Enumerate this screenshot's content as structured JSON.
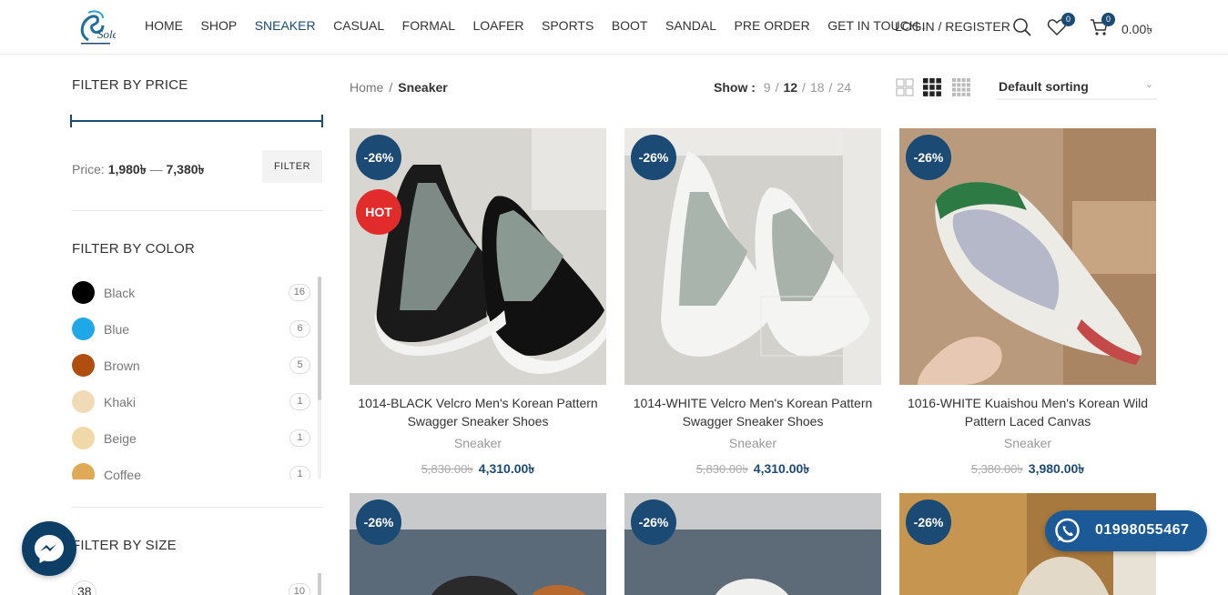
{
  "brand": {
    "logo_text": "Sole",
    "accent": "#1b4a74",
    "hot_color": "#e22b2b"
  },
  "nav": {
    "items": [
      {
        "label": "HOME"
      },
      {
        "label": "SHOP"
      },
      {
        "label": "SNEAKER"
      },
      {
        "label": "CASUAL"
      },
      {
        "label": "FORMAL"
      },
      {
        "label": "LOAFER"
      },
      {
        "label": "SPORTS"
      },
      {
        "label": "BOOT"
      },
      {
        "label": "SANDAL"
      },
      {
        "label": "PRE ORDER"
      },
      {
        "label": "GET IN TOUCH"
      }
    ],
    "active": "SNEAKER",
    "login": "LOGIN / REGISTER",
    "wishlist_count": "0",
    "cart_count": "0",
    "cart_total": "0.00৳"
  },
  "sidebar": {
    "price_title": "FILTER BY PRICE",
    "price_label": "Price:",
    "price_min": "1,980৳",
    "price_dash": "—",
    "price_max": "7,380৳",
    "filter_button": "FILTER",
    "color_title": "FILTER BY COLOR",
    "colors": [
      {
        "name": "Black",
        "count": "16",
        "hex": "#000000"
      },
      {
        "name": "Blue",
        "count": "6",
        "hex": "#1ea8e8"
      },
      {
        "name": "Brown",
        "count": "5",
        "hex": "#b04e0f"
      },
      {
        "name": "Khaki",
        "count": "1",
        "hex": "#f0dbb6"
      },
      {
        "name": "Beige",
        "count": "1",
        "hex": "#f0d8a8"
      },
      {
        "name": "Coffee",
        "count": "1",
        "hex": "#dfaa55"
      }
    ],
    "size_title": "FILTER BY SIZE",
    "sizes": [
      {
        "name": "38",
        "count": "10"
      }
    ]
  },
  "toolbar": {
    "breadcrumb": [
      "Home",
      "Sneaker"
    ],
    "show_label": "Show :",
    "show_options": [
      "9",
      "12",
      "18",
      "24"
    ],
    "show_selected": "12",
    "sort_label": "Default sorting"
  },
  "products": [
    {
      "discount": "-26%",
      "hot": "HOT",
      "name": "1014-BLACK Velcro Men's Korean Pattern Swagger Sneaker Shoes",
      "category": "Sneaker",
      "old_price": "5,830.00৳",
      "price": "4,310.00৳"
    },
    {
      "discount": "-26%",
      "name": "1014-WHITE Velcro Men's Korean Pattern Swagger Sneaker Shoes",
      "category": "Sneaker",
      "old_price": "5,830.00৳",
      "price": "4,310.00৳"
    },
    {
      "discount": "-26%",
      "name": "1016-WHITE Kuaishou Men's Korean Wild Pattern Laced Canvas",
      "category": "Sneaker",
      "old_price": "5,380.00৳",
      "price": "3,980.00৳"
    },
    {
      "discount": "-26%"
    },
    {
      "discount": "-26%"
    },
    {
      "discount": "-26%"
    }
  ],
  "whatsapp": {
    "phone": "01998055467"
  },
  "icons": [
    "search-icon",
    "heart-icon",
    "cart-icon",
    "grid-2-icon",
    "grid-3-icon",
    "grid-4-icon",
    "messenger-icon",
    "whatsapp-icon"
  ]
}
